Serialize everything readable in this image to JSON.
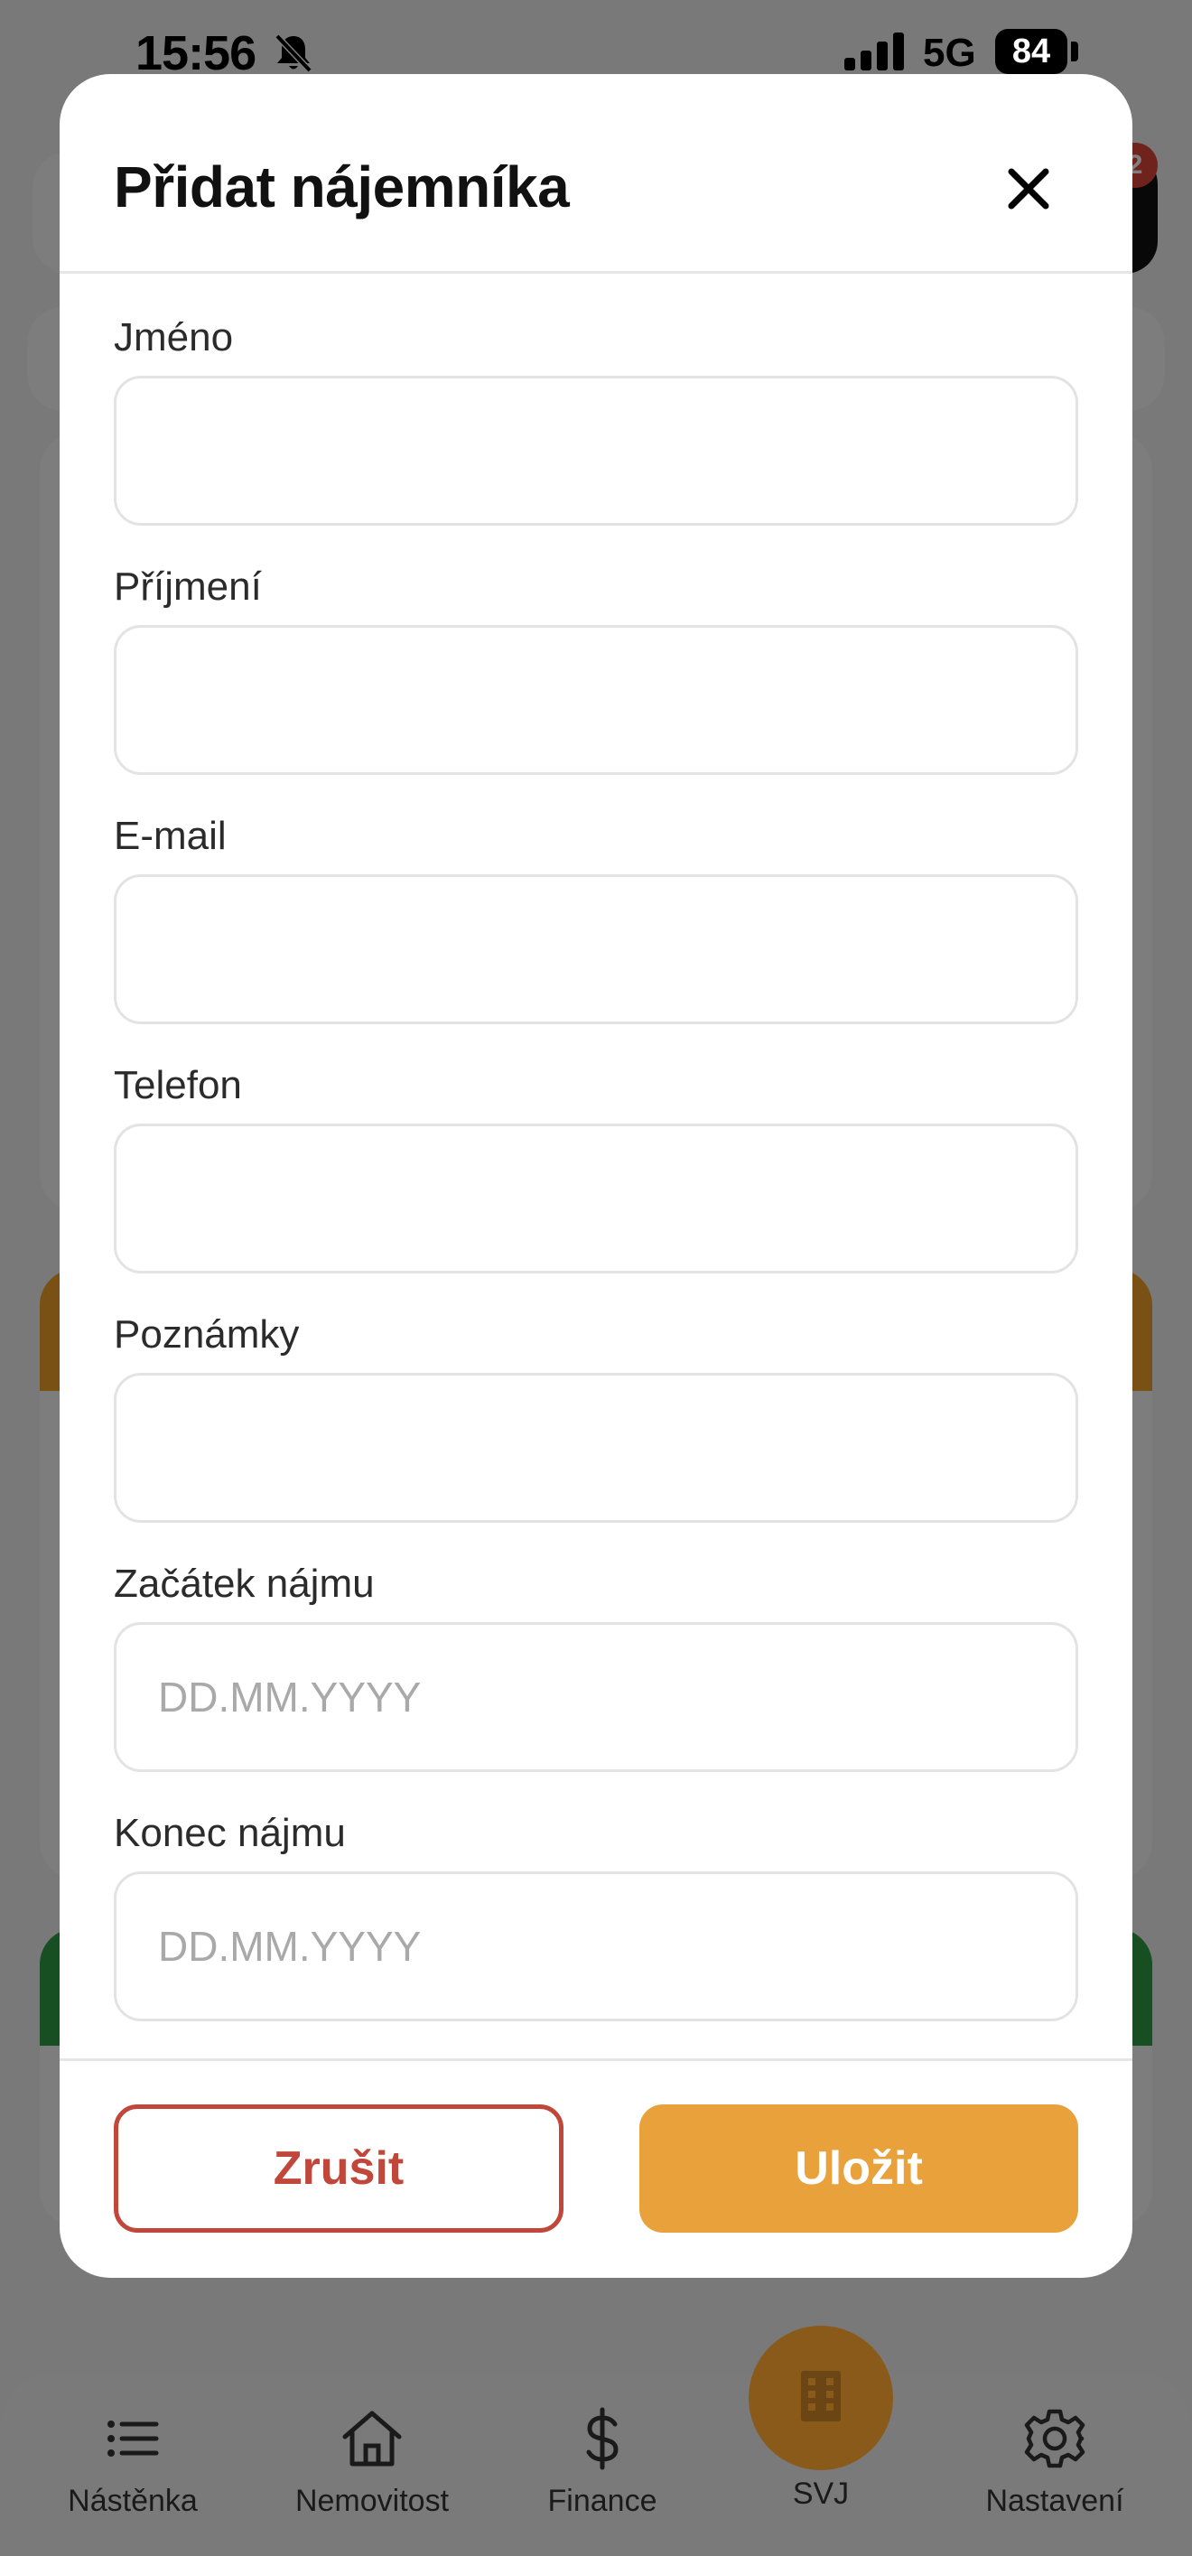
{
  "status_bar": {
    "time": "15:56",
    "network": "5G",
    "battery": "84"
  },
  "background": {
    "notification_count": "2"
  },
  "modal": {
    "title": "Přidat nájemníka",
    "fields": [
      {
        "label": "Jméno",
        "value": "",
        "placeholder": ""
      },
      {
        "label": "Příjmení",
        "value": "",
        "placeholder": ""
      },
      {
        "label": "E-mail",
        "value": "",
        "placeholder": ""
      },
      {
        "label": "Telefon",
        "value": "",
        "placeholder": ""
      },
      {
        "label": "Poznámky",
        "value": "",
        "placeholder": ""
      },
      {
        "label": "Začátek nájmu",
        "value": "",
        "placeholder": "DD.MM.YYYY"
      },
      {
        "label": "Konec nájmu",
        "value": "",
        "placeholder": "DD.MM.YYYY"
      }
    ],
    "cancel_label": "Zrušit",
    "save_label": "Uložit"
  },
  "tabbar": {
    "items": [
      {
        "label": "Nástěnka",
        "icon": "list-icon"
      },
      {
        "label": "Nemovitost",
        "icon": "house-icon"
      },
      {
        "label": "Finance",
        "icon": "dollar-icon"
      },
      {
        "label": "SVJ",
        "icon": "building-icon"
      },
      {
        "label": "Nastavení",
        "icon": "gear-icon"
      }
    ]
  },
  "colors": {
    "accent": "#e9a23b",
    "danger": "#c0473a"
  }
}
